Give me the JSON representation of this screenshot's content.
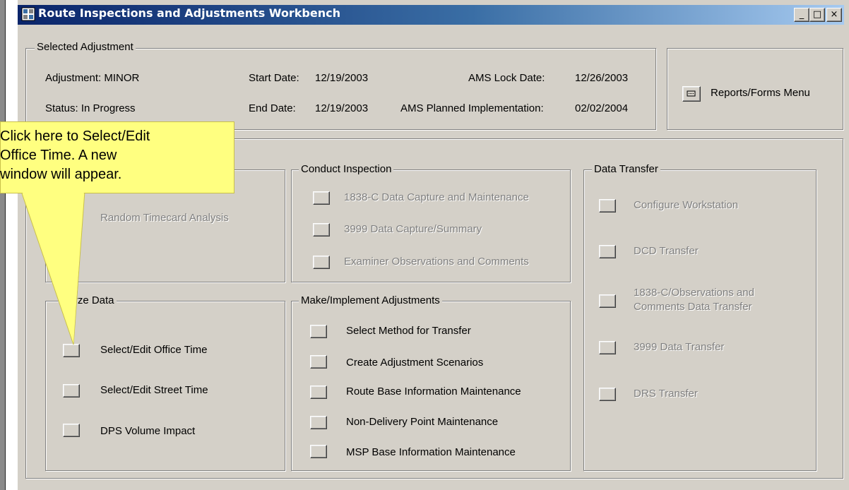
{
  "window": {
    "title": "Route Inspections and Adjustments Workbench",
    "minimize_glyph": "_",
    "maximize_glyph": "□",
    "close_glyph": "×"
  },
  "selected_adjustment": {
    "group_title": "Selected Adjustment",
    "adjustment": "Adjustment: MINOR",
    "status": "Status:  In Progress",
    "start_label": "Start Date:",
    "start_value": "12/19/2003",
    "end_label": "End Date:",
    "end_value": "12/19/2003",
    "lock_label": "AMS Lock Date:",
    "lock_value": "12/26/2003",
    "planned_label": "AMS Planned Implementation:",
    "planned_value": "02/02/2004"
  },
  "reports_button": {
    "label": "Reports/Forms Menu",
    "icon": "menu-icon"
  },
  "conduct_inspection": {
    "title": "Conduct Inspection",
    "items": [
      "1838-C Data Capture and Maintenance",
      "3999  Data Capture/Summary",
      "Examiner Observations and Comments"
    ]
  },
  "random_timecard": {
    "label": "Random Timecard Analysis"
  },
  "data_transfer": {
    "title": "Data Transfer",
    "items": [
      "Configure Workstation",
      "DCD Transfer",
      "1838-C/Observations and\nComments Data Transfer",
      "3999 Data Transfer",
      "DRS Transfer"
    ]
  },
  "analyze_data": {
    "title": "Analyze Data",
    "visible_title": "lyze Data",
    "items": [
      "Select/Edit Office Time",
      "Select/Edit Street Time",
      "DPS Volume Impact"
    ]
  },
  "make_implement": {
    "title": "Make/Implement Adjustments",
    "items": [
      "Select Method for Transfer",
      "Create Adjustment Scenarios",
      "Route Base Information Maintenance",
      "Non-Delivery Point Maintenance",
      "MSP Base Information Maintenance"
    ]
  },
  "callout": {
    "text": "Click here to Select/Edit\nOffice Time.  A new\nwindow will appear.",
    "color": "#ffff80"
  },
  "colors": {
    "title_start": "#0a246a",
    "title_end": "#a6caf0",
    "face": "#d4d0c8"
  }
}
